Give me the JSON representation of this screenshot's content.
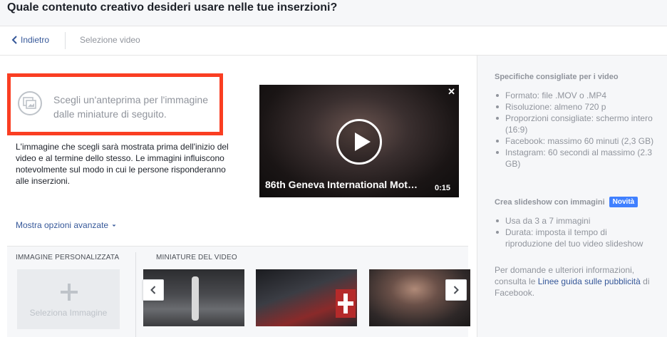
{
  "header": {
    "title": "Quale contenuto creativo desideri usare nelle tue inserzioni?"
  },
  "nav": {
    "back_label": "Indietro",
    "crumb": "Selezione video"
  },
  "thumbnail": {
    "prompt": "Scegli un'anteprima per l'immagine dalle miniature di seguito.",
    "description": "L'immagine che scegli sarà mostrata prima dell'inizio del video e al termine dello stesso. Le immagini influiscono notevolmente sul modo in cui le persone risponderanno alle inserzioni.",
    "advanced_label": "Mostra opzioni avanzate"
  },
  "video": {
    "title": "86th Geneva International Moto…",
    "duration": "0:15",
    "close_glyph": "✕"
  },
  "bottom": {
    "custom_label": "IMMAGINE PERSONALIZZATA",
    "select_label": "Seleziona Immagine",
    "minis_label": "MINIATURE DEL VIDEO"
  },
  "specs": {
    "title": "Specifiche consigliate per i video",
    "items": [
      "Formato: file .MOV o .MP4",
      "Risoluzione: almeno 720 p",
      "Proporzioni consigliate: schermo intero (16:9)",
      "Facebook: massimo 60 minuti (2,3 GB)",
      "Instagram: 60 secondi al massimo (2.3 GB)"
    ]
  },
  "slideshow": {
    "title": "Crea slideshow con immagini",
    "badge": "Novità",
    "items": [
      "Usa da 3 a 7 immagini",
      "Durata: imposta il tempo di riproduzione del tuo video slideshow"
    ]
  },
  "contact": {
    "prefix": "Per domande e ulteriori informazioni, consulta le ",
    "link": "Linee guida sulle pubblicità",
    "suffix": " di Facebook."
  },
  "colors": {
    "accent": "#365899",
    "highlight": "#fa3e22",
    "badge": "#4080ff"
  }
}
